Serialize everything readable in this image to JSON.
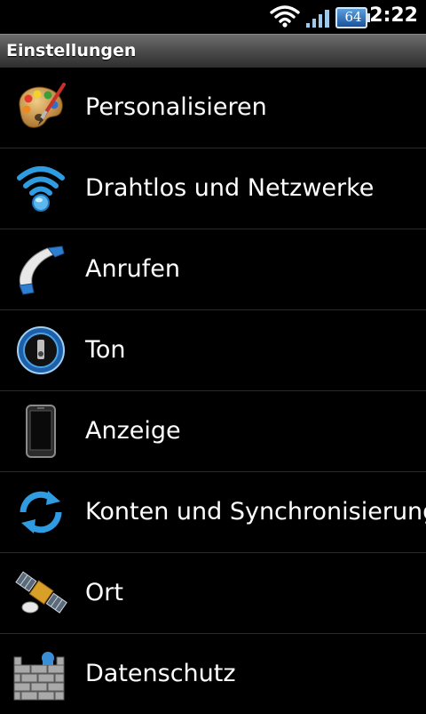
{
  "status_bar": {
    "battery_level": "64",
    "time": "2:22",
    "icons": [
      "wifi-icon",
      "signal-icon",
      "battery-icon"
    ]
  },
  "header": {
    "title": "Einstellungen"
  },
  "settings": {
    "items": [
      {
        "label": "Personalisieren",
        "icon": "palette-icon"
      },
      {
        "label": "Drahtlos und Netzwerke",
        "icon": "wifi-icon"
      },
      {
        "label": "Anrufen",
        "icon": "phone-icon"
      },
      {
        "label": "Ton",
        "icon": "speaker-icon"
      },
      {
        "label": "Anzeige",
        "icon": "display-phone-icon"
      },
      {
        "label": "Konten und Synchronisierung",
        "icon": "sync-icon"
      },
      {
        "label": "Ort",
        "icon": "satellite-icon"
      },
      {
        "label": "Datenschutz",
        "icon": "firewall-icon"
      }
    ]
  },
  "colors": {
    "background": "#000000",
    "text": "#ffffff",
    "accent_blue": "#2f9be0",
    "divider": "#2a2a2a"
  }
}
